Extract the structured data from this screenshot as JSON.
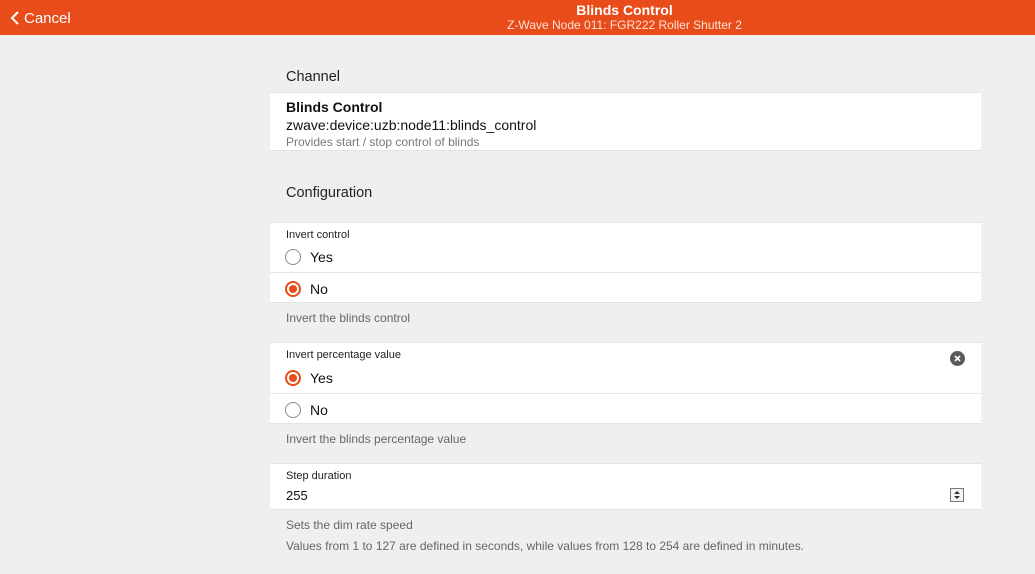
{
  "header": {
    "back_label": "Cancel",
    "title": "Blinds Control",
    "subtitle": "Z-Wave Node 011: FGR222 Roller Shutter 2",
    "accent_color": "#e84c1a"
  },
  "channel": {
    "section_title": "Channel",
    "name": "Blinds Control",
    "uid": "zwave:device:uzb:node11:blinds_control",
    "description": "Provides start / stop control of blinds"
  },
  "configuration": {
    "section_title": "Configuration",
    "invert_control": {
      "label": "Invert control",
      "options": [
        {
          "label": "Yes",
          "checked": false
        },
        {
          "label": "No",
          "checked": true
        }
      ],
      "hint": "Invert the blinds control"
    },
    "invert_percentage": {
      "label": "Invert percentage value",
      "options": [
        {
          "label": "Yes",
          "checked": true
        },
        {
          "label": "No",
          "checked": false
        }
      ],
      "hint": "Invert the blinds percentage value",
      "clear_icon": "clear-icon"
    },
    "step_duration": {
      "label": "Step duration",
      "value": "255",
      "hint": "Sets the dim rate speed",
      "hint2": "Values from 1 to 127 are defined in seconds, while values from 128 to 254 are defined in minutes."
    }
  }
}
